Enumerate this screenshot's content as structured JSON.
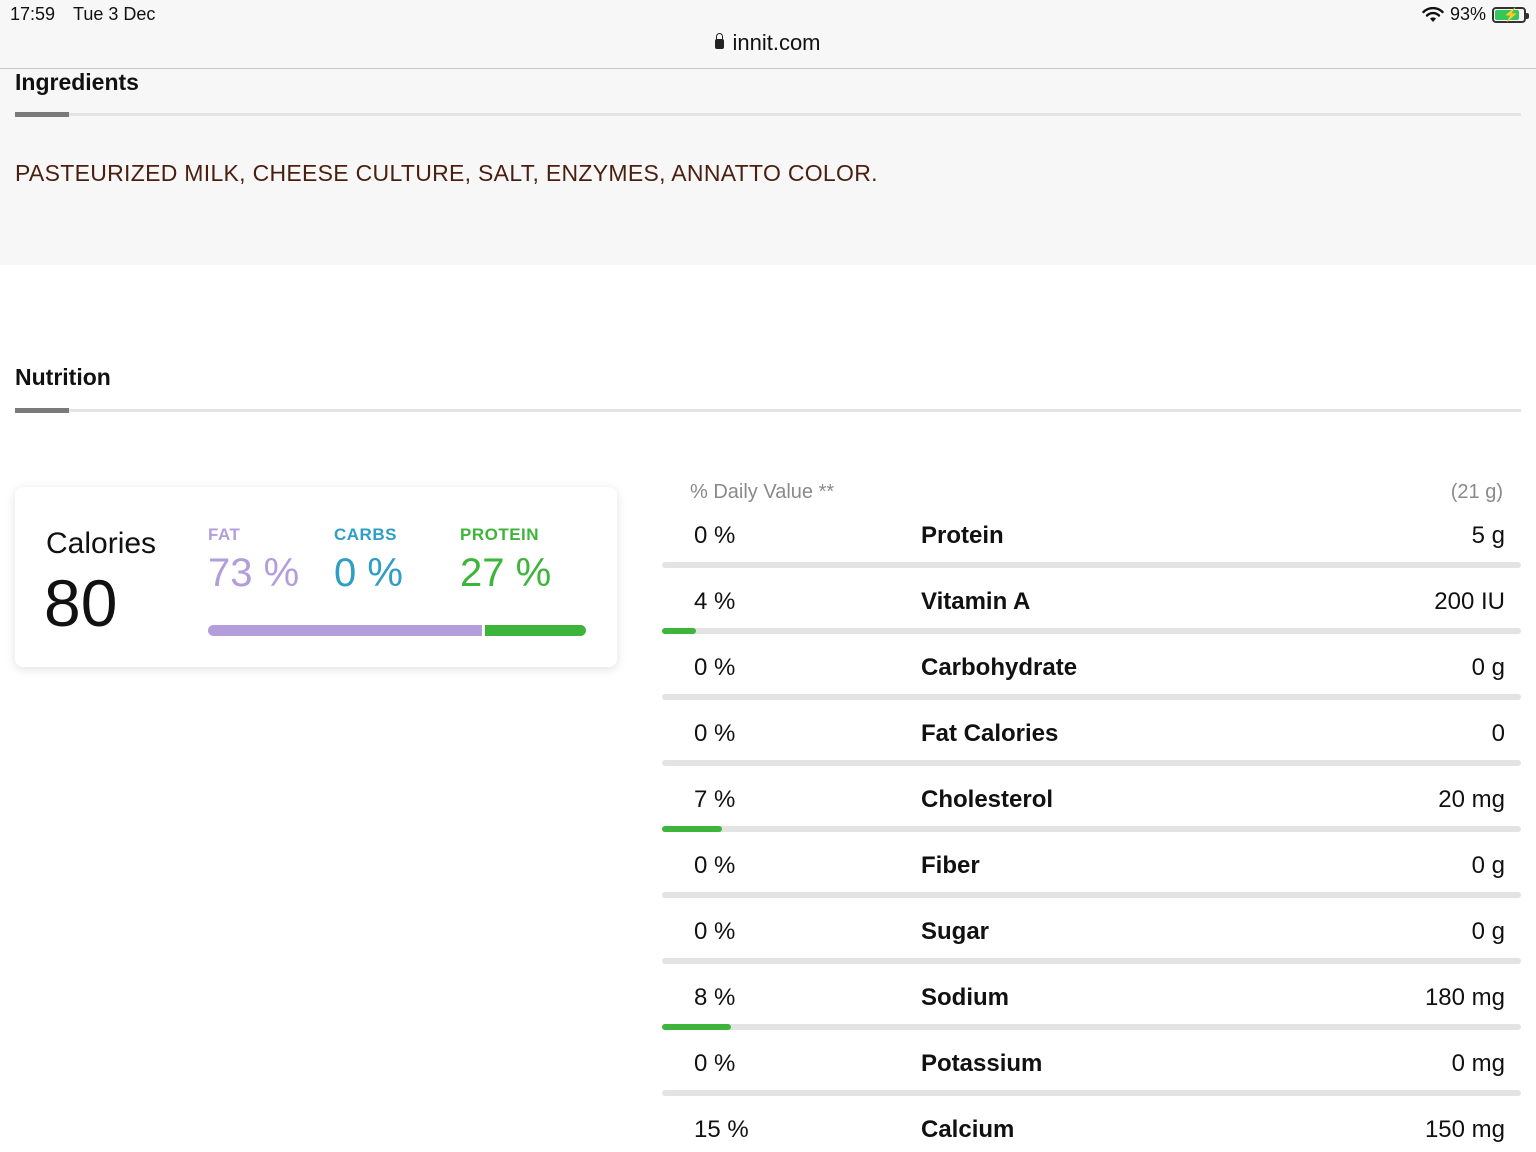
{
  "status_bar": {
    "time": "17:59",
    "date": "Tue 3 Dec",
    "battery": "93%",
    "battery_level": 0.93
  },
  "url_bar": {
    "domain": "innit.com"
  },
  "ingredients": {
    "title": "Ingredients",
    "text": "PASTEURIZED MILK, CHEESE CULTURE, SALT, ENZYMES, ANNATTO COLOR."
  },
  "nutrition": {
    "title": "Nutrition",
    "calories": {
      "label": "Calories",
      "value": "80"
    },
    "macros": [
      {
        "label": "FAT",
        "value": "73 %",
        "fraction": 0.73,
        "color": "#b39ddb"
      },
      {
        "label": "CARBS",
        "value": "0 %",
        "fraction": 0.0,
        "color": "#2e9ec4"
      },
      {
        "label": "PROTEIN",
        "value": "27 %",
        "fraction": 0.27,
        "color": "#3db53a"
      }
    ],
    "table": {
      "header_left": "% Daily Value **",
      "header_right": "(21 g)",
      "bar_color": "#3db53a",
      "rows": [
        {
          "pct": "0 %",
          "name": "Protein",
          "amount": "5 g",
          "dv": 0
        },
        {
          "pct": "4 %",
          "name": "Vitamin A",
          "amount": "200 IU",
          "dv": 0.04
        },
        {
          "pct": "0 %",
          "name": "Carbohydrate",
          "amount": "0 g",
          "dv": 0
        },
        {
          "pct": "0 %",
          "name": "Fat Calories",
          "amount": "0",
          "dv": 0
        },
        {
          "pct": "7 %",
          "name": "Cholesterol",
          "amount": "20 mg",
          "dv": 0.07
        },
        {
          "pct": "0 %",
          "name": "Fiber",
          "amount": "0 g",
          "dv": 0
        },
        {
          "pct": "0 %",
          "name": "Sugar",
          "amount": "0 g",
          "dv": 0
        },
        {
          "pct": "8 %",
          "name": "Sodium",
          "amount": "180 mg",
          "dv": 0.08
        },
        {
          "pct": "0 %",
          "name": "Potassium",
          "amount": "0 mg",
          "dv": 0
        },
        {
          "pct": "15 %",
          "name": "Calcium",
          "amount": "150 mg",
          "dv": 0.15
        }
      ]
    }
  }
}
